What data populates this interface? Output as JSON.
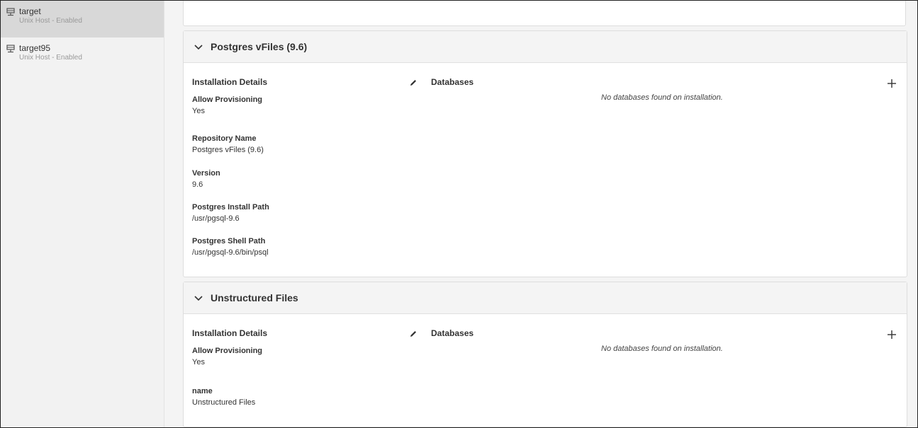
{
  "sidebar": {
    "hosts": [
      {
        "name": "target",
        "status": "Unix Host - Enabled"
      },
      {
        "name": "target95",
        "status": "Unix Host - Enabled"
      }
    ]
  },
  "panels": [
    {
      "title": "Postgres vFiles (9.6)",
      "details_title": "Installation Details",
      "databases_title": "Databases",
      "no_databases": "No databases found on installation.",
      "fields": [
        {
          "label": "Allow Provisioning",
          "value": "Yes"
        },
        {
          "label": "Repository Name",
          "value": "Postgres vFiles (9.6)"
        },
        {
          "label": "Version",
          "value": "9.6"
        },
        {
          "label": "Postgres Install Path",
          "value": "/usr/pgsql-9.6"
        },
        {
          "label": "Postgres Shell Path",
          "value": "/usr/pgsql-9.6/bin/psql"
        }
      ]
    },
    {
      "title": "Unstructured Files",
      "details_title": "Installation Details",
      "databases_title": "Databases",
      "no_databases": "No databases found on installation.",
      "fields": [
        {
          "label": "Allow Provisioning",
          "value": "Yes"
        },
        {
          "label": "name",
          "value": "Unstructured Files"
        }
      ]
    }
  ],
  "icons": {
    "host": "host-icon",
    "chevron": "chevron-down-icon",
    "edit": "pencil-icon",
    "add": "plus-icon"
  }
}
